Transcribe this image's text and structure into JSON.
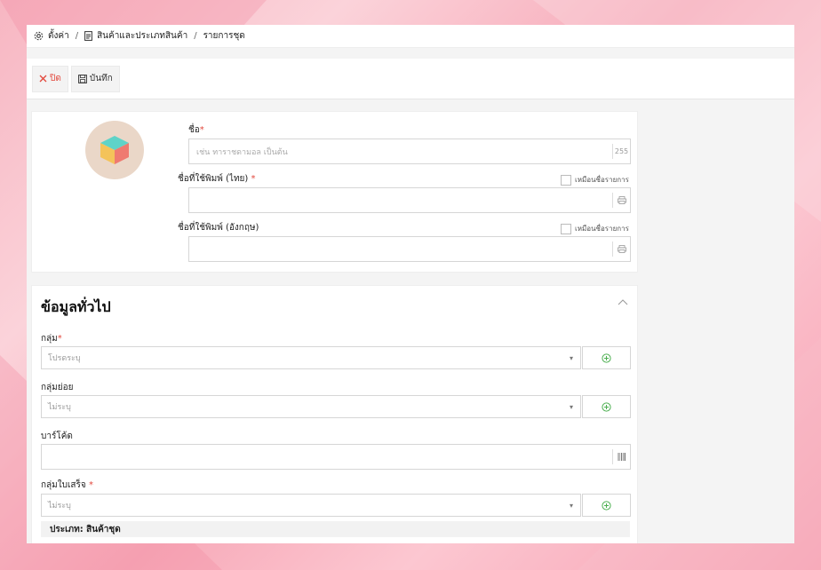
{
  "breadcrumb": {
    "settings": "ตั้งค่า",
    "products": "สินค้าและประเภทสินค้า",
    "current": "รายการชุด",
    "separator": "/"
  },
  "toolbar": {
    "close_label": "ปิด",
    "save_label": "บันทึก"
  },
  "product": {
    "name_label": "ชื่อ",
    "name_placeholder": "เช่น ทาราชดามอล เป็นต้น",
    "name_suffix": "255",
    "print_th_label": "ชื่อที่ใช้พิมพ์ (ไทย)",
    "print_th_check": "เหมือนชื่อรายการ",
    "print_en_label": "ชื่อที่ใช้พิมพ์ (อังกฤษ)",
    "print_en_check": "เหมือนชื่อรายการ",
    "required_mark": "*"
  },
  "general": {
    "title": "ข้อมูลทั่วไป",
    "group_label": "กลุ่ม",
    "group_value": "โปรดระบุ",
    "subgroup_label": "กลุ่มย่อย",
    "subgroup_value": "ไม่ระบุ",
    "barcode_label": "บาร์โค้ด",
    "receipt_group_label": "กลุ่มใบเสร็จ",
    "receipt_group_value": "ไม่ระบุ",
    "type_label": "ประเภท: สินค้าชุด",
    "required_mark": "*"
  },
  "colors": {
    "accent_red": "#e2483d",
    "add_green": "#4caf50"
  }
}
